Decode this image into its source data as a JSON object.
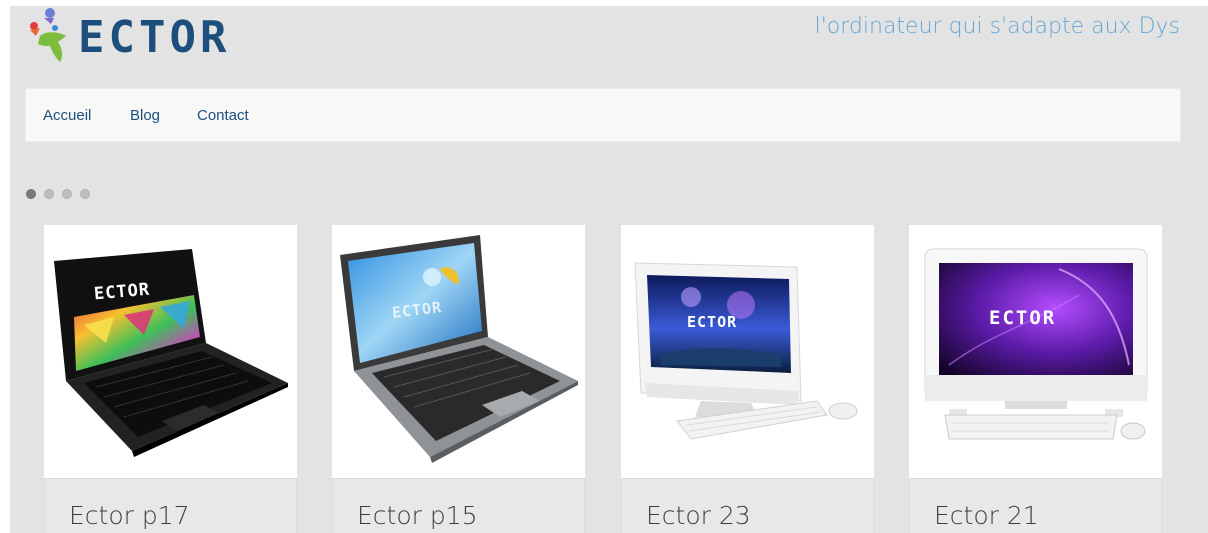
{
  "brand": {
    "logo_text": "ECTOR",
    "tagline": "l'ordinateur qui s'adapte aux Dys",
    "colors": {
      "navy": "#1e4f7c",
      "tagline": "#62a7d6"
    }
  },
  "nav": {
    "items": [
      {
        "label": "Accueil"
      },
      {
        "label": "Blog"
      },
      {
        "label": "Contact"
      }
    ]
  },
  "carousel": {
    "dot_count": 4,
    "active_index": 0
  },
  "products": [
    {
      "name": "Ector p17",
      "icon": "laptop-black-image",
      "screen_text": "ECTOR"
    },
    {
      "name": "Ector p15",
      "icon": "laptop-gray-image",
      "screen_text": "ECTOR"
    },
    {
      "name": "Ector 23",
      "icon": "all-in-one-white-image",
      "screen_text": "ECTOR"
    },
    {
      "name": "Ector 21",
      "icon": "all-in-one-silver-image",
      "screen_text": "ECTOR"
    }
  ]
}
